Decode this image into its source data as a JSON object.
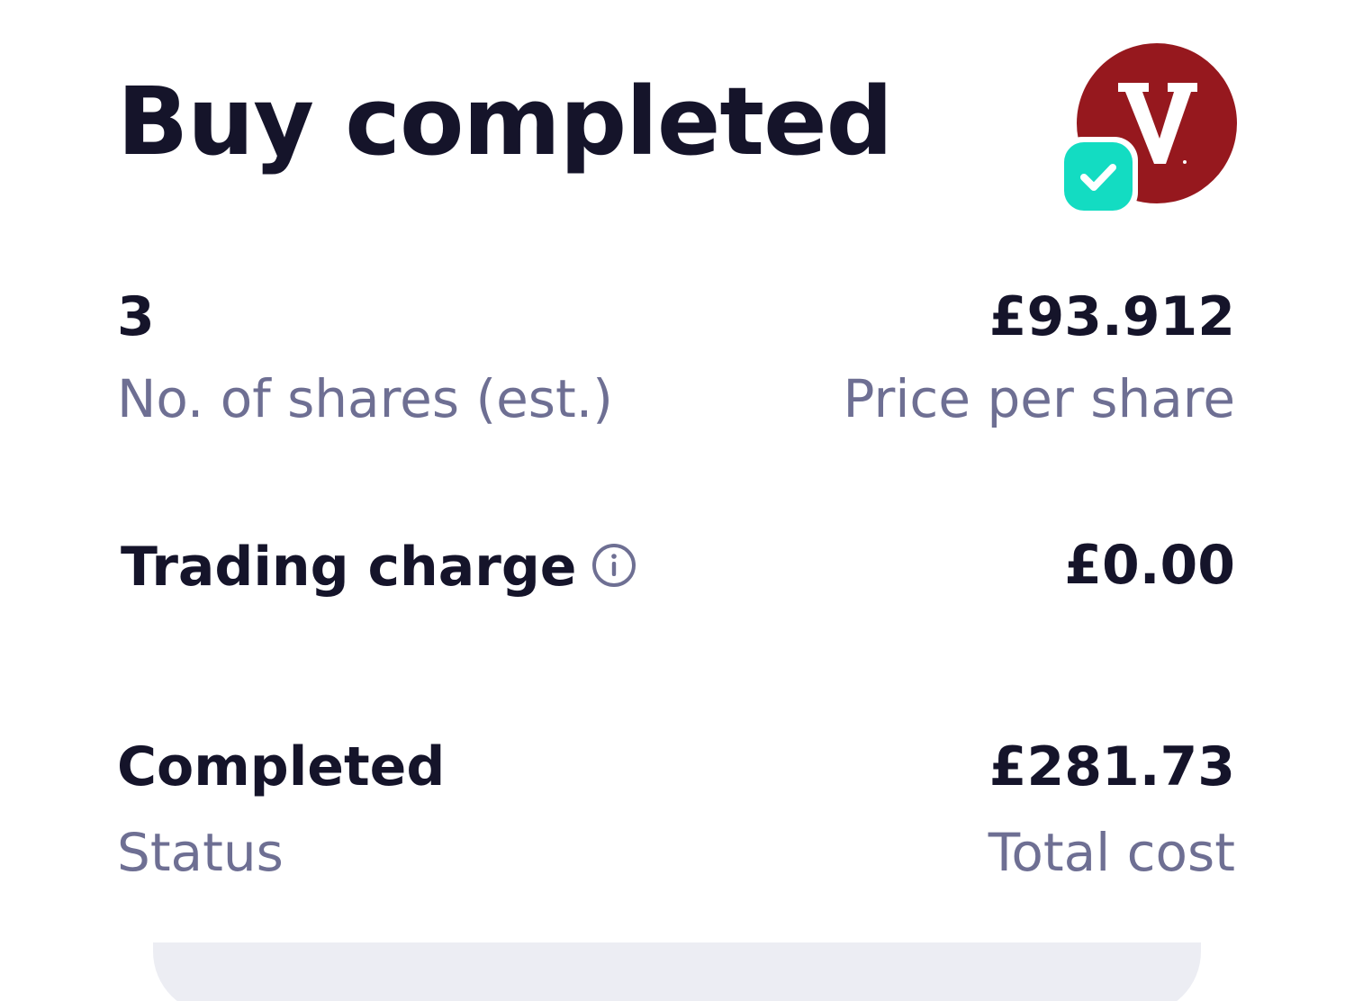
{
  "header": {
    "title": "Buy completed"
  },
  "fund": {
    "logo_letter": "V",
    "logo_icon": "vanguard-logo",
    "status_icon": "check-icon",
    "brand_color": "#96181e",
    "check_color": "#13dcc2"
  },
  "shares": {
    "value": "3",
    "label": "No. of shares (est.)"
  },
  "price": {
    "value": "£93.912",
    "label": "Price per share"
  },
  "trading_charge": {
    "label": "Trading charge",
    "icon": "info-icon",
    "value": "£0.00"
  },
  "status": {
    "value": "Completed",
    "label": "Status"
  },
  "total": {
    "value": "£281.73",
    "label": "Total cost"
  },
  "colors": {
    "primary_text": "#15142a",
    "secondary_text": "#6e6f93",
    "card_bg": "#ecedf3"
  }
}
